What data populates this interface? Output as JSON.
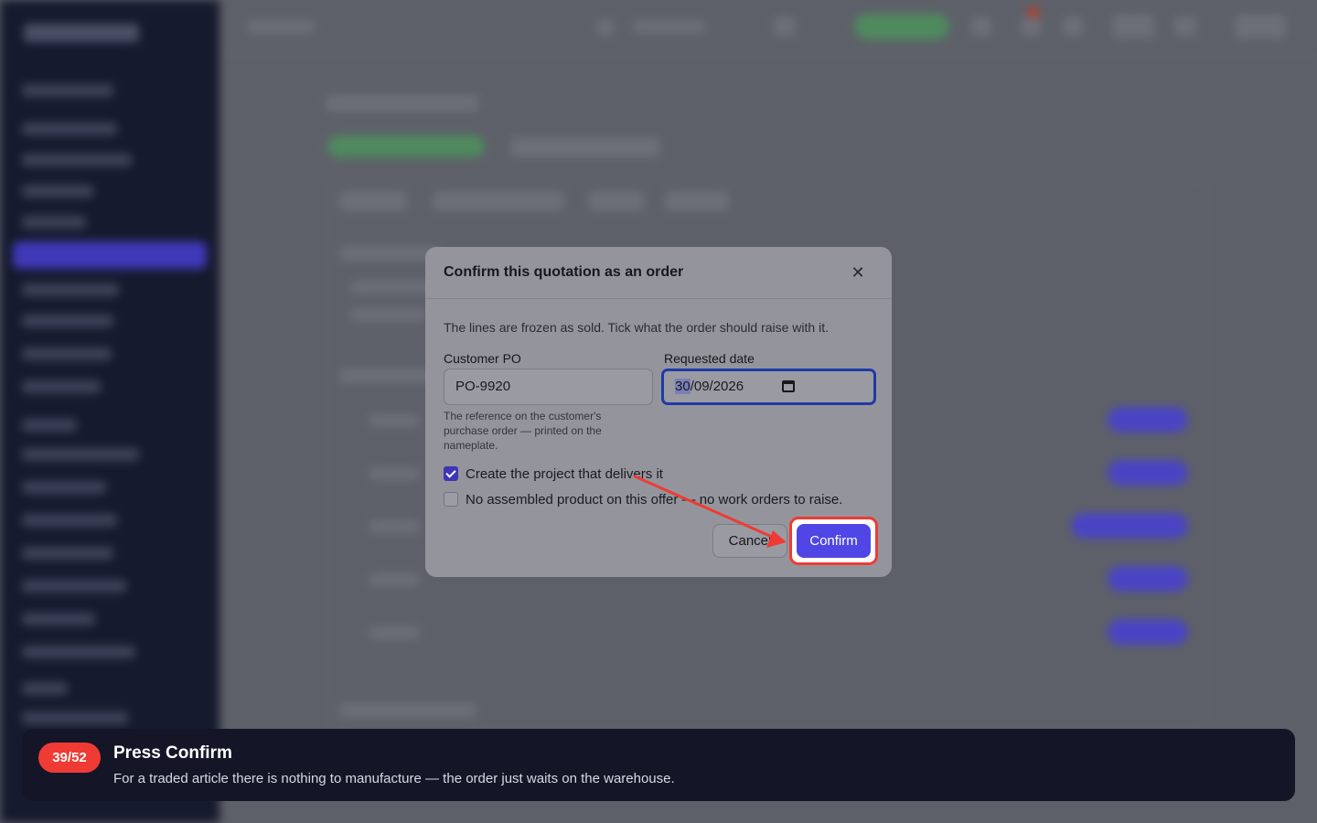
{
  "dialog": {
    "title": "Confirm this quotation as an order",
    "intro": "The lines are frozen as sold. Tick what the order should raise with it.",
    "customer_po": {
      "label": "Customer PO",
      "value": "PO-9920",
      "hint": "The reference on the customer's purchase order — printed on the nameplate."
    },
    "requested_date": {
      "label": "Requested date",
      "day": "30",
      "rest": "/09/2026"
    },
    "create_project": {
      "label": "Create the project that delivers it",
      "checked": true
    },
    "no_assembled": {
      "label": "No assembled product on this offer — no work orders to raise.",
      "checked": false
    },
    "cancel_label": "Cancel",
    "confirm_label": "Confirm"
  },
  "tour": {
    "step": "39/52",
    "title": "Press Confirm",
    "text": "For a traded article there is nothing to manufacture — the order just waits on the warehouse."
  },
  "colors": {
    "primary": "#4f46e5",
    "highlight": "#ef3b34",
    "tour_bg": "#141628"
  },
  "icons": {
    "close": "close-icon",
    "calendar": "calendar-icon",
    "arrow": "pointer-arrow"
  }
}
